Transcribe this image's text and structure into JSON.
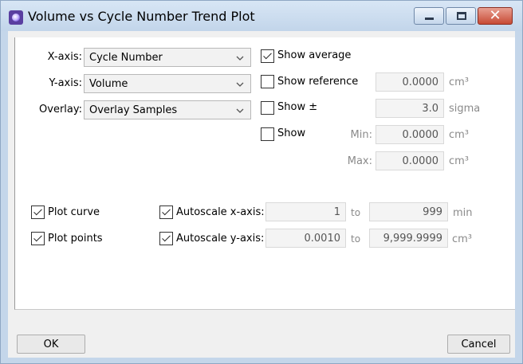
{
  "window": {
    "title": "Volume vs Cycle Number Trend Plot"
  },
  "axes": {
    "x_label": "X-axis:",
    "x_value": "Cycle Number",
    "y_label": "Y-axis:",
    "y_value": "Volume",
    "overlay_label": "Overlay:",
    "overlay_value": "Overlay Samples"
  },
  "options": {
    "show_average": {
      "label": "Show average",
      "checked": true
    },
    "show_reference": {
      "label": "Show reference",
      "checked": false,
      "value": "0.0000",
      "unit": "cm³"
    },
    "show_pm": {
      "label": "Show ±",
      "checked": false,
      "value": "3.0",
      "unit": "sigma"
    },
    "show": {
      "label": "Show",
      "checked": false,
      "min_label": "Min:",
      "min_value": "0.0000",
      "min_unit": "cm³",
      "max_label": "Max:",
      "max_value": "0.0000",
      "max_unit": "cm³"
    }
  },
  "plot": {
    "curve": {
      "label": "Plot curve",
      "checked": true
    },
    "points": {
      "label": "Plot points",
      "checked": true
    },
    "autoscale_x": {
      "label": "Autoscale x-axis:",
      "checked": true,
      "from": "1",
      "to_label": "to",
      "to": "999",
      "unit": "min"
    },
    "autoscale_y": {
      "label": "Autoscale y-axis:",
      "checked": true,
      "from": "0.0010",
      "to_label": "to",
      "to": "9,999.9999",
      "unit": "cm³"
    }
  },
  "buttons": {
    "ok": "OK",
    "cancel": "Cancel"
  }
}
